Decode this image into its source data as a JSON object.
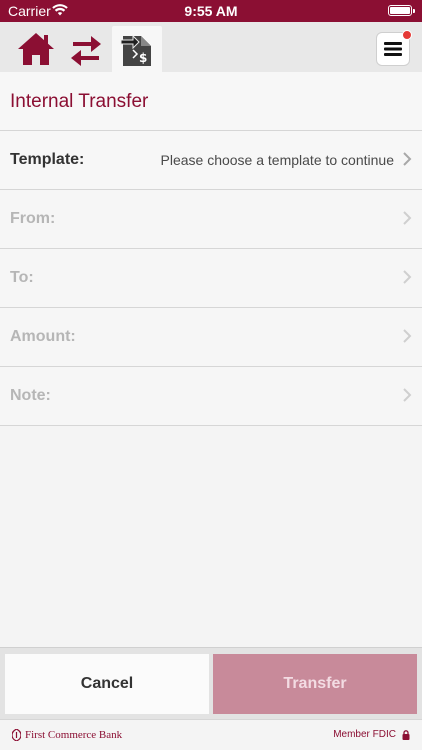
{
  "status_bar": {
    "carrier": "Carrier",
    "time": "9:55 AM"
  },
  "nav": {
    "icons": [
      "home-icon",
      "transfers-icon",
      "internal-transfer-icon",
      "menu-icon"
    ],
    "active_tab": "internal-transfer",
    "notification": true
  },
  "page": {
    "title": "Internal Transfer"
  },
  "form": {
    "template": {
      "label": "Template:",
      "value": "Please choose a template to continue"
    },
    "from": {
      "label": "From:"
    },
    "to": {
      "label": "To:"
    },
    "amount": {
      "label": "Amount:"
    },
    "note": {
      "label": "Note:"
    }
  },
  "buttons": {
    "cancel": "Cancel",
    "transfer": "Transfer"
  },
  "footer": {
    "bank_name": "First Commerce Bank",
    "member": "Member FDIC"
  },
  "colors": {
    "brand": "#8b0f33",
    "transfer_disabled": "#c88a9a",
    "notification": "#e53935"
  }
}
